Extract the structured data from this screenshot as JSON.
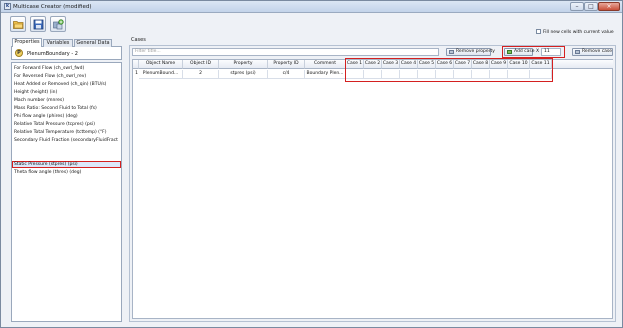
{
  "window": {
    "title": "Multicase Creator (modified)",
    "app_icon": "app-icon",
    "controls": {
      "minimize": "–",
      "maximize": "□",
      "close": "×"
    }
  },
  "toolbar": {
    "buttons": [
      {
        "name": "open-folder-icon"
      },
      {
        "name": "save-icon"
      },
      {
        "name": "add-items-icon"
      }
    ]
  },
  "left_panel": {
    "tabs": [
      "Properties",
      "Variables",
      "General Data"
    ],
    "active_tab": "Properties",
    "node": {
      "icon_letter": "P",
      "label": "PlenumBoundary - 2"
    },
    "properties": [
      "For Forward Flow (ch_swrl_fwd)",
      "For Reversed Flow (ch_swrl_rev)",
      "Heat Added or Removed (ch_qin)  (BTU/s)",
      "Height (height)  (in)",
      "Mach number (mnres)",
      "Mass Ratio: Second Fluid to Total (fs)",
      "Phi flow angle (phires)  (deg)",
      "Relative Total Pressure (tcpres)  (psi)",
      "Relative Total Temperature (tcttemp)  (°F)",
      "Secondary Fluid Fraction (secondaryFluidFract",
      "Static Pressure (stpres)  (psi)",
      "Theta flow angle (thres)  (deg)"
    ],
    "selected_index": 10
  },
  "cases": {
    "label": "Cases",
    "filter_placeholder": "Filter title...",
    "fill_checkbox_label": "Fill new cells with current value",
    "remove_property_label": "Remove property",
    "add_case_label": "Add case",
    "x_label": "X",
    "case_count": "11",
    "remove_case_label": "Remove case",
    "columns": [
      "Object Name",
      "Object ID",
      "Property",
      "Property ID",
      "Comment",
      "Case 1",
      "Case 2",
      "Case 3",
      "Case 4",
      "Case 5",
      "Case 6",
      "Case 7",
      "Case 8",
      "Case 9",
      "Case 10",
      "Case 11"
    ],
    "rows": [
      {
        "num": "1",
        "cells": [
          "PlenumBound...",
          "2",
          "stpres (psi)",
          "c/4",
          "Boundary Plen...",
          "",
          "",
          "",
          "",
          "",
          "",
          "",
          "",
          "",
          "",
          ""
        ]
      }
    ]
  }
}
